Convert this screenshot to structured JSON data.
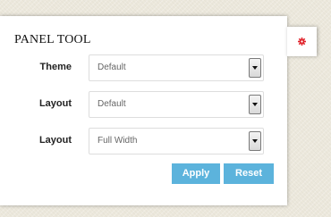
{
  "panel": {
    "title": "PANEL TOOL",
    "fields": [
      {
        "label": "Theme",
        "value": "Default"
      },
      {
        "label": "Layout",
        "value": "Default"
      },
      {
        "label": "Layout",
        "value": "Full Width"
      }
    ],
    "buttons": {
      "apply_label": "Apply",
      "reset_label": "Reset"
    }
  },
  "gear_tab": {
    "icon": "gear-icon",
    "color": "#e0222a"
  },
  "colors": {
    "button": "#5cb3dc",
    "background": "#ece8dc"
  }
}
